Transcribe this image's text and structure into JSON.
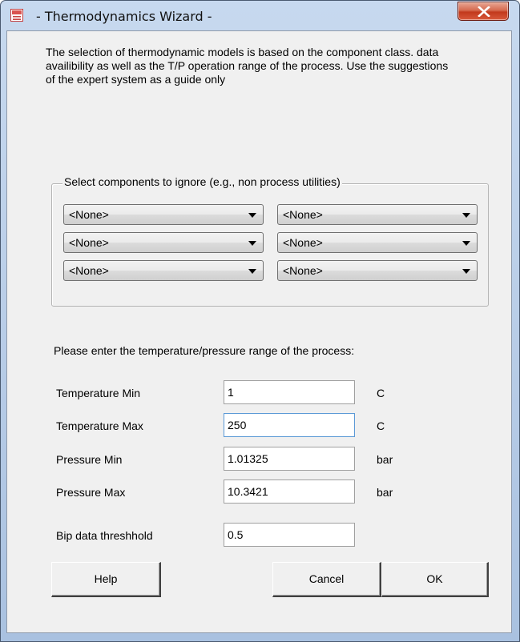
{
  "window": {
    "title": "- Thermodynamics Wizard -"
  },
  "intro_text": "The selection of thermodynamic models is based on the component class. data availibility as well as the T/P operation range of the process.  Use the suggestions of the expert system as a guide only",
  "components": {
    "legend": "Select components to ignore (e.g., non process utilities)",
    "dropdowns": [
      {
        "value": "<None>"
      },
      {
        "value": "<None>"
      },
      {
        "value": "<None>"
      },
      {
        "value": "<None>"
      },
      {
        "value": "<None>"
      },
      {
        "value": "<None>"
      }
    ]
  },
  "range": {
    "prompt": "Please enter the temperature/pressure range of the process:",
    "fields": [
      {
        "label": "Temperature Min",
        "value": "1",
        "unit": "C"
      },
      {
        "label": "Temperature Max",
        "value": "250",
        "unit": "C"
      },
      {
        "label": "Pressure Min",
        "value": "1.01325",
        "unit": "bar"
      },
      {
        "label": "Pressure Max",
        "value": "10.3421",
        "unit": "bar"
      },
      {
        "label": "Bip data threshhold",
        "value": "0.5",
        "unit": ""
      }
    ]
  },
  "buttons": {
    "help": "Help",
    "cancel": "Cancel",
    "ok": "OK"
  },
  "icons": {
    "app": "document-app-icon",
    "close": "close-icon",
    "dropdown": "dropdown-arrow-icon"
  }
}
